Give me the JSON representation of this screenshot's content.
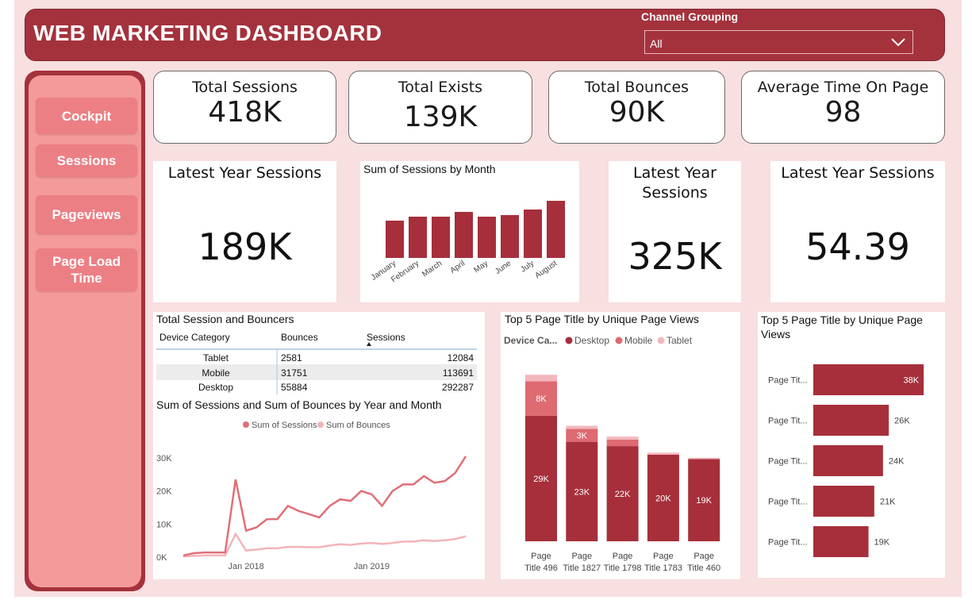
{
  "header": {
    "title": "WEB MARKETING DASHBOARD",
    "channel_label": "Channel Grouping",
    "channel_value": "All"
  },
  "nav": {
    "items": [
      "Cockpit",
      "Sessions",
      "Pageviews",
      "Page Load Time"
    ]
  },
  "kpis": [
    {
      "label": "Total Sessions",
      "value": "418K"
    },
    {
      "label": "Total Exists",
      "value": "139K"
    },
    {
      "label": "Total Bounces",
      "value": "90K"
    },
    {
      "label": "Average Time On Page",
      "value": "98"
    }
  ],
  "latest1": {
    "label": "Latest Year Sessions",
    "value": "189K"
  },
  "latest2": {
    "label": "Latest Year Sessions",
    "value": "325K"
  },
  "latest3": {
    "label": "Latest Year Sessions",
    "value": "54.39"
  },
  "table": {
    "title": "Total Session and Bouncers",
    "columns": [
      "Device Category",
      "Bounces",
      "Sessions"
    ],
    "rows": [
      {
        "category": "Tablet",
        "bounces": "2581",
        "sessions": "12084"
      },
      {
        "category": "Mobile",
        "bounces": "31751",
        "sessions": "113691"
      },
      {
        "category": "Desktop",
        "bounces": "55884",
        "sessions": "292287"
      }
    ]
  },
  "colors": {
    "primary": "#a4323d",
    "bar": "#a62f3b",
    "mobile": "#de6a72",
    "tablet": "#f3b8bd",
    "sessions_line": "#e06f77",
    "bounces_line": "#f3b4b9",
    "background": "#f8dfe0"
  },
  "chart_data": [
    {
      "type": "bar",
      "title": "Sum of Sessions by Month",
      "categories": [
        "January",
        "February",
        "March",
        "April",
        "May",
        "June",
        "July",
        "August"
      ],
      "values": [
        47,
        52,
        52,
        58,
        52,
        54,
        61,
        72
      ]
    },
    {
      "type": "line",
      "title": "Sum of Sessions and Sum of Bounces by Year and Month",
      "x_ticks": [
        "Jan 2018",
        "Jan 2019"
      ],
      "y_ticks": [
        "0K",
        "10K",
        "20K",
        "30K"
      ],
      "ylim": [
        0,
        30000
      ],
      "legend_position": "top",
      "series": [
        {
          "name": "Sum of Sessions",
          "values": [
            500,
            1200,
            1400,
            1400,
            1400,
            23500,
            8000,
            9000,
            11500,
            11500,
            15500,
            14000,
            13000,
            12000,
            15500,
            17500,
            17000,
            20000,
            19000,
            15500,
            20000,
            22000,
            22000,
            24500,
            22500,
            23000,
            25500,
            30500
          ]
        },
        {
          "name": "Sum of Bounces",
          "values": [
            200,
            400,
            500,
            500,
            500,
            7000,
            2000,
            2300,
            2700,
            2700,
            3100,
            3100,
            3000,
            3000,
            3500,
            3900,
            3700,
            4100,
            4300,
            4000,
            4300,
            4700,
            4700,
            5100,
            4900,
            5100,
            5500,
            6300
          ]
        }
      ]
    },
    {
      "type": "bar",
      "title": "Top 5 Page Title by Unique Page Views",
      "legend_title": "Device Ca...",
      "categories": [
        "Page Title 496",
        "Page Title 1827",
        "Page Title 1798",
        "Page Title 1783",
        "Page Title 460"
      ],
      "stacked": true,
      "series": [
        {
          "name": "Desktop",
          "values": [
            29,
            23,
            22,
            20,
            19
          ],
          "labels": [
            "29K",
            "23K",
            "22K",
            "20K",
            "19K"
          ]
        },
        {
          "name": "Mobile",
          "values": [
            8,
            3,
            1.5,
            0,
            0
          ],
          "labels": [
            "8K",
            "3K",
            "",
            "",
            ""
          ]
        },
        {
          "name": "Tablet",
          "values": [
            1.5,
            0.7,
            0.7,
            0.5,
            0.3
          ],
          "labels": [
            "",
            "",
            "",
            "",
            ""
          ]
        }
      ]
    },
    {
      "type": "bar",
      "orientation": "horizontal",
      "title": "Top 5 Page Title by Unique Page Views",
      "categories": [
        "Page Tit...",
        "Page Tit...",
        "Page Tit...",
        "Page Tit...",
        "Page Tit..."
      ],
      "values": [
        38,
        26,
        24,
        21,
        19
      ],
      "labels": [
        "38K",
        "26K",
        "24K",
        "21K",
        "19K"
      ]
    }
  ]
}
